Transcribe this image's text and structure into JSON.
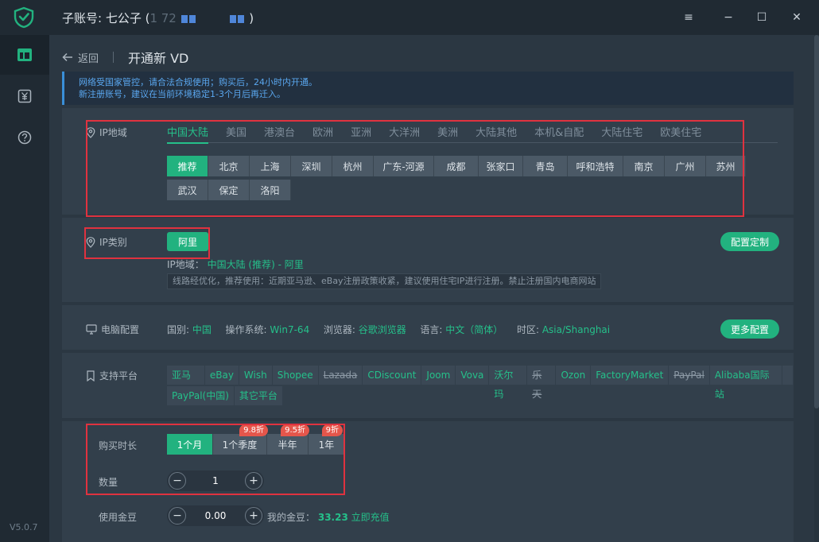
{
  "window": {
    "title_prefix": "子账号: 七公子 (",
    "title_masked": "1  72",
    "title_suffix": ")",
    "minimize_icon": "≡",
    "min_icon": "−",
    "max_icon": "☐",
    "close_icon": "✕"
  },
  "sidebar": {
    "version": "V5.0.7"
  },
  "header": {
    "back_label": "返回",
    "page_title": "开通新 VD"
  },
  "notice": {
    "line1": "网络受国家管控，请合法合规使用；购买后，24小时内开通。",
    "line2": "新注册账号，建议在当前环境稳定1-3个月后再迁入。"
  },
  "region": {
    "label": "IP地域",
    "tabs": [
      "中国大陆",
      "美国",
      "港澳台",
      "欧洲",
      "亚洲",
      "大洋洲",
      "美洲",
      "大陆其他",
      "本机&自配",
      "大陆住宅",
      "欧美住宅"
    ],
    "cities_row1": [
      "推荐",
      "北京",
      "上海",
      "深圳",
      "杭州",
      "广东-河源",
      "成都",
      "张家口",
      "青岛",
      "呼和浩特",
      "南京",
      "广州",
      "苏州"
    ],
    "cities_row2": [
      "武汉",
      "保定",
      "洛阳"
    ]
  },
  "ip_type": {
    "label": "IP类别",
    "option": "阿里",
    "config_btn": "配置定制",
    "region_label": "IP地域：",
    "region_value": "中国大陆 (推荐) - 阿里",
    "hint": "线路经优化，推荐使用：近期亚马逊、eBay注册政策收紧，建议使用住宅IP进行注册。禁止注册国内电商网站"
  },
  "pc_config": {
    "label": "电脑配置",
    "country_label": "国别:",
    "country": "中国",
    "os_label": "操作系统:",
    "os": "Win7-64",
    "browser_label": "浏览器:",
    "browser": "谷歌浏览器",
    "lang_label": "语言:",
    "lang": "中文（简体）",
    "tz_label": "时区:",
    "tz": "Asia/Shanghai",
    "more_btn": "更多配置"
  },
  "platforms": {
    "label": "支持平台",
    "row1": [
      "亚马逊",
      "eBay",
      "Wish",
      "Shopee",
      "Lazada",
      "CDiscount",
      "Joom",
      "Vova",
      "沃尔玛",
      "乐天",
      "Ozon",
      "FactoryMarket",
      "PayPal",
      "Alibaba国际站",
      ""
    ],
    "row2": [
      "PayPal(中国)",
      "其它平台"
    ]
  },
  "purchase": {
    "duration_label": "购买时长",
    "durations": [
      "1个月",
      "1个季度",
      "半年",
      "1年"
    ],
    "discounts": [
      "9.8折",
      "9.5折",
      "9折"
    ],
    "qty_label": "数量",
    "qty_value": "1",
    "beans_label": "使用金豆",
    "beans_value": "0.00",
    "my_beans_label": "我的金豆：",
    "my_beans": "33.23",
    "recharge": "立即充值"
  }
}
